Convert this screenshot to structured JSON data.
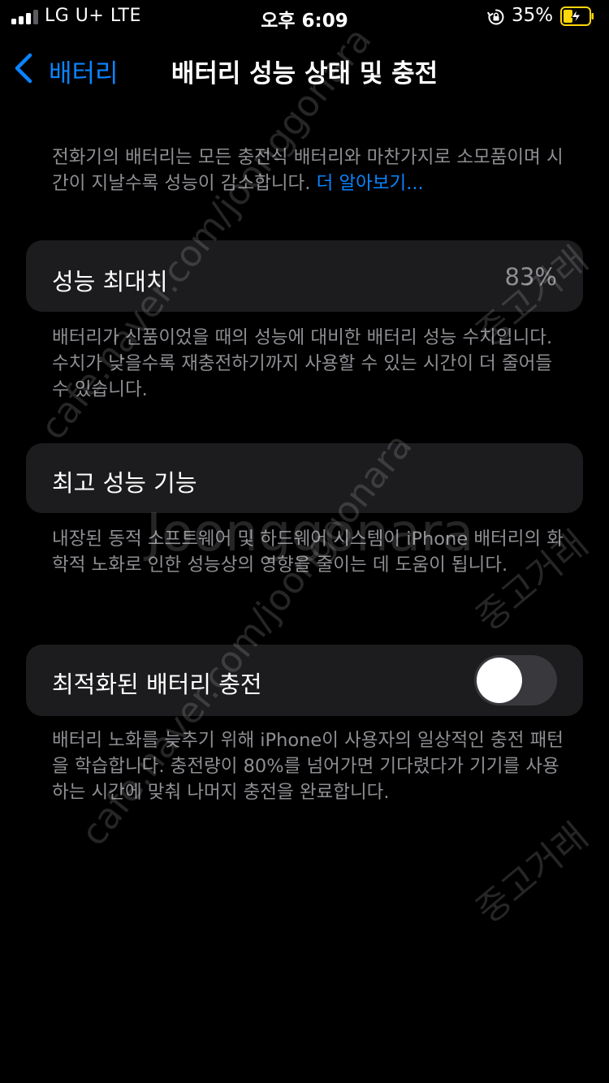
{
  "status_bar": {
    "carrier": "LG U+  LTE",
    "time": "오후 6:09",
    "battery_percent": "35%",
    "signal_bars_filled": 3,
    "signal_bars_total": 4
  },
  "nav": {
    "back_label": "배터리",
    "title": "배터리 성능 상태 및 충전"
  },
  "intro": {
    "text": "전화기의 배터리는 모든 충전식 배터리와 마찬가지로 소모품이며 시간이 지날수록 성능이 감소합니다. ",
    "link": "더 알아보기..."
  },
  "max_capacity": {
    "label": "성능 최대치",
    "value": "83%",
    "description": "배터리가 신품이었을 때의 성능에 대비한 배터리 성능 수치입니다. 수치가 낮을수록 재충전하기까지 사용할 수 있는 시간이 더 줄어들 수 있습니다."
  },
  "peak_performance": {
    "label": "최고 성능 기능",
    "description": "내장된 동적 소프트웨어 및 하드웨어 시스템이 iPhone 배터리의 화학적 노화로 인한 성능상의 영향을 줄이는 데 도움이 됩니다."
  },
  "optimized_charging": {
    "label": "최적화된 배터리 충전",
    "enabled": false,
    "description": "배터리 노화를 늦추기 위해 iPhone이 사용자의 일상적인 충전 패턴을 학습합니다. 충전량이 80%를 넘어가면 기다렸다가 기기를 사용하는 시간에 맞춰 나머지 충전을 완료합니다."
  },
  "watermarks": {
    "url": "cafe.naver.com/joonggonara",
    "brand": "Joonggonara",
    "korean": "중고거래"
  },
  "colors": {
    "background": "#000000",
    "cell": "#1c1c1e",
    "accent": "#0a84ff",
    "secondary_text": "#8e8e93",
    "toggle_off": "#39393d",
    "battery_charging": "#ffd60a"
  }
}
